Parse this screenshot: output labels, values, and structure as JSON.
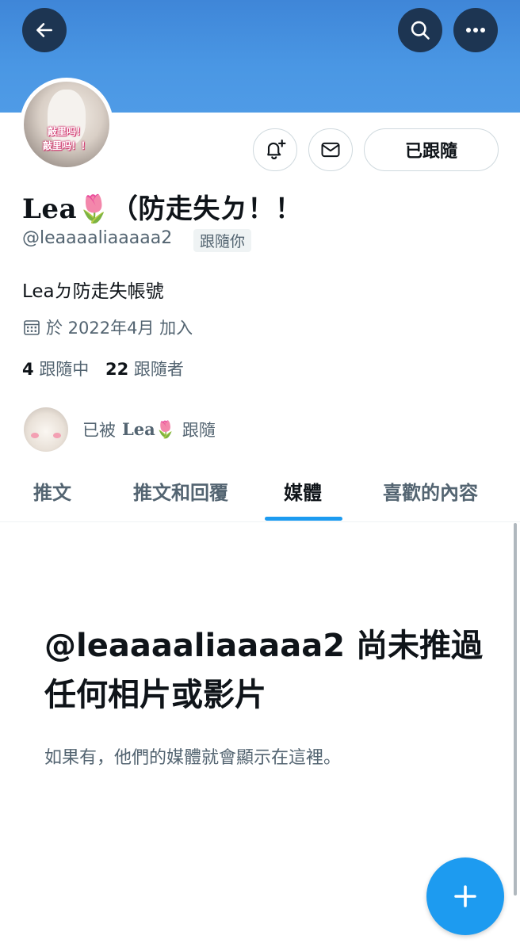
{
  "profile": {
    "display_name": "Lea🌷（防走失ㄉ！！",
    "handle": "@leaaaaliaaaaa2",
    "follows_you_badge": "跟隨你",
    "bio": "Leaㄉ防走失帳號",
    "joined": "於 2022年4月 加入",
    "following_count": "4",
    "following_label": "跟隨中",
    "followers_count": "22",
    "followers_label": "跟隨者",
    "avatar_caption_line1": "敲里吗！",
    "avatar_caption_line2": "敲里吗！！"
  },
  "actions": {
    "notify_icon": "bell-plus-icon",
    "message_icon": "mail-icon",
    "following_button": "已跟隨"
  },
  "header": {
    "back_icon": "arrow-left-icon",
    "search_icon": "search-icon",
    "more_icon": "more-icon"
  },
  "mutual": {
    "prefix": "已被",
    "name": "Lea🌷",
    "suffix": "跟隨"
  },
  "tabs": [
    {
      "label": "推文",
      "active": false
    },
    {
      "label": "推文和回覆",
      "active": false
    },
    {
      "label": "媒體",
      "active": true
    },
    {
      "label": "喜歡的內容",
      "active": false
    }
  ],
  "empty_state": {
    "title": "@leaaaaliaaaaa2 尚未推過任何相片或影片",
    "subtitle": "如果有，他們的媒體就會顯示在這裡。"
  },
  "fab": {
    "icon": "plus-icon"
  },
  "colors": {
    "banner": "#4a97e4",
    "accent": "#1d9bf0",
    "header_button": "#1d3552",
    "secondary_text": "#536471"
  }
}
